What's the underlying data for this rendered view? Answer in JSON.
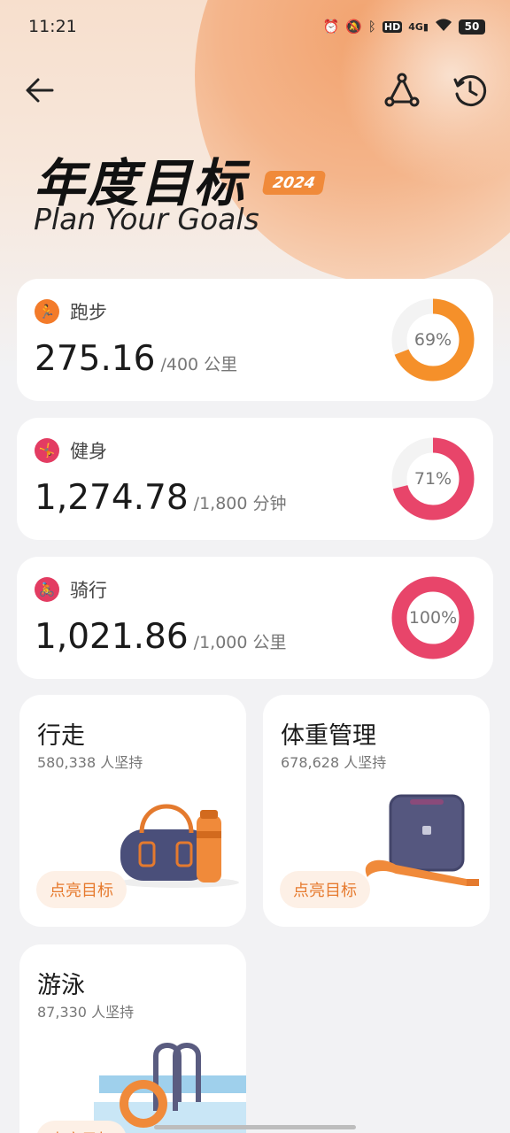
{
  "status_bar": {
    "time": "11:21",
    "icons": [
      "alarm-icon",
      "mute-icon",
      "bluetooth-icon",
      "hd-icon",
      "4g-signal-icon",
      "wifi-icon"
    ],
    "battery": "50"
  },
  "header": {
    "title": "年度目标",
    "year": "2024",
    "subtitle": "Plan Your Goals"
  },
  "goals": [
    {
      "name": "跑步",
      "value": "275.16",
      "target": "/400 公里",
      "percent_label": "69%",
      "progress": 0.69,
      "color": "#f5902a",
      "icon": "running-icon"
    },
    {
      "name": "健身",
      "value": "1,274.78",
      "target": "/1,800 分钟",
      "percent_label": "71%",
      "progress": 0.71,
      "color": "#e8456a",
      "icon": "fitness-icon"
    },
    {
      "name": "骑行",
      "value": "1,021.86",
      "target": "/1,000 公里",
      "percent_label": "100%",
      "progress": 1.0,
      "color": "#e8456a",
      "icon": "cycling-icon"
    }
  ],
  "tiles": [
    {
      "title": "行走",
      "participants": "580,338 人坚持",
      "button": "点亮目标"
    },
    {
      "title": "体重管理",
      "participants": "678,628 人坚持",
      "button": "点亮目标"
    },
    {
      "title": "游泳",
      "participants": "87,330 人坚持",
      "button": "点亮目标"
    }
  ],
  "colors": {
    "accent": "#f08a3a",
    "pink": "#e8456a",
    "background": "#f2f2f4"
  }
}
